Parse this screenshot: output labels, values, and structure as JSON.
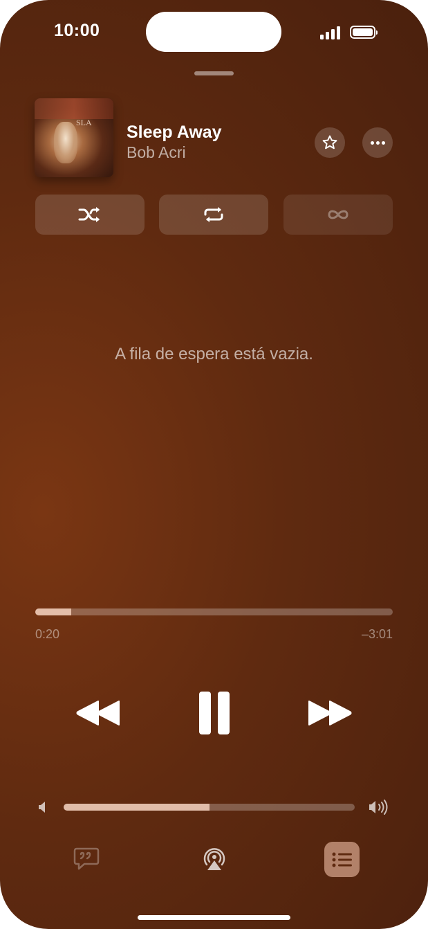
{
  "status_bar": {
    "time": "10:00"
  },
  "now_playing": {
    "title": "Sleep Away",
    "artist": "Bob Acri",
    "artwork_text": "SLA"
  },
  "queue": {
    "empty_message": "A fila de espera está vazia."
  },
  "playback": {
    "elapsed": "0:20",
    "remaining": "–3:01",
    "progress_fraction": 0.1,
    "volume_fraction": 0.5
  },
  "colors": {
    "background": "#5f2a10",
    "accent_fill": "#f0c8b4",
    "text_primary": "#ffffff"
  },
  "icons": {
    "favorite": "star-icon",
    "more": "ellipsis-icon",
    "shuffle": "shuffle-icon",
    "repeat": "repeat-icon",
    "autoplay": "infinity-icon",
    "rewind": "rewind-icon",
    "pause": "pause-icon",
    "forward": "fast-forward-icon",
    "volume_low": "speaker-low-icon",
    "volume_high": "speaker-high-icon",
    "lyrics": "lyrics-icon",
    "airplay": "airplay-icon",
    "queue": "queue-list-icon"
  }
}
